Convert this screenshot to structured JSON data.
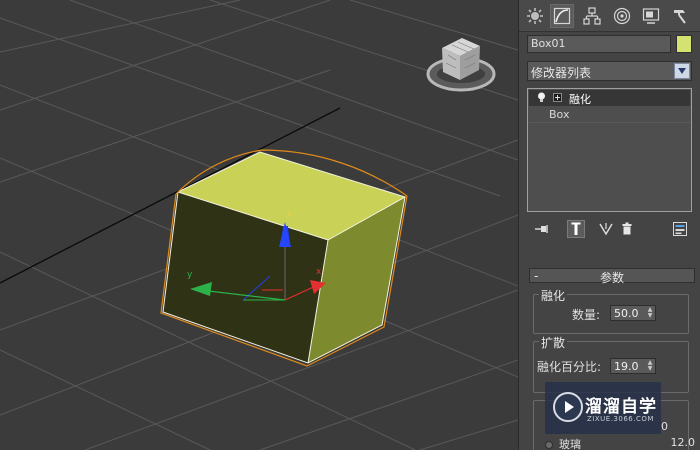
{
  "object": {
    "name": "Box01",
    "color": "#d4e270"
  },
  "modifier_list": {
    "label": "修改器列表"
  },
  "stack": [
    {
      "label": "融化",
      "selected": true
    },
    {
      "label": "Box",
      "selected": false
    }
  ],
  "parameters": {
    "rollout_title": "参数",
    "melt_group": {
      "title": "融化",
      "amount_label": "数量:",
      "amount_value": "50.0"
    },
    "spread_group": {
      "title": "扩散",
      "percent_label": "融化百分比:",
      "percent_value": "19.0"
    },
    "solidity": {
      "label": "玻璃",
      "value": "12.0",
      "partial_value": "0"
    }
  },
  "viewport": {
    "gizmo_x": "x",
    "gizmo_y": "y",
    "gizmo_z": "z"
  },
  "watermark": {
    "title": "溜溜自学",
    "url": "ZIXUE.3066.COM"
  },
  "tabs": [
    "create-tab",
    "modify-tab",
    "hierarchy-tab",
    "motion-tab",
    "display-tab",
    "utilities-tab"
  ],
  "colors": {
    "viewport_bg": "#3b3b3b",
    "panel_bg": "#444444",
    "box_face": "#c8d256",
    "selection": "#e08a1a"
  }
}
